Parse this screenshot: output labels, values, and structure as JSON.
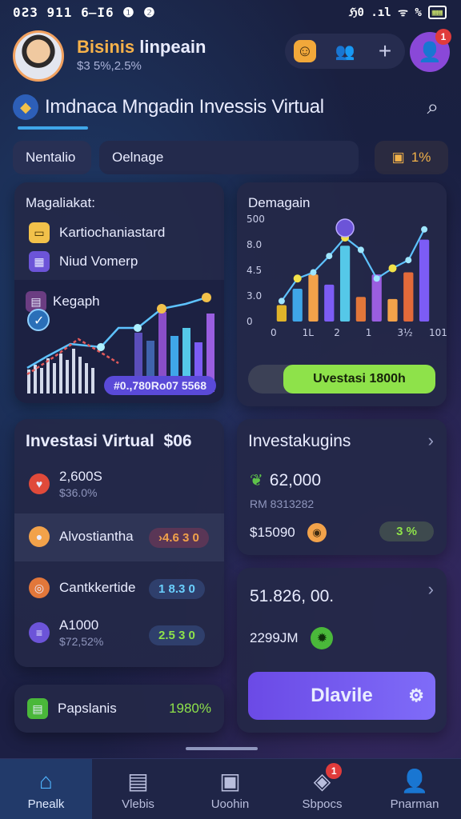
{
  "status": {
    "time": "0Ƨ3 911 6̶Ι6 ❶ ❷",
    "right": "ℌ0 .ıl ᯤ %",
    "battery": "▦▦"
  },
  "profile": {
    "name_hi": "Bisinis",
    "name_rest": "linpeain",
    "sub": "$3 5%,2.5%",
    "badge": "1"
  },
  "header": {
    "title": "Imdnaca Mngadin Invessis Virtual"
  },
  "tabs": {
    "t1": "Nentalio",
    "t2": "Oelnage",
    "t3": "1%"
  },
  "left_card": {
    "title": "Magaliakat:",
    "item1": "Kartiochaniastard",
    "item2": "Niud Vomerp",
    "graph_label": "Kegaph",
    "graph_value": "#0.,780Ro07 5568"
  },
  "right_chart": {
    "title": "Demagain",
    "button": "Uvestasi 1800h",
    "y_ticks": [
      "500",
      "8.0",
      "4.5",
      "3.0",
      "0"
    ],
    "x_ticks": [
      "0",
      "1L",
      "2",
      "1",
      "3½",
      "101"
    ]
  },
  "chart_data": {
    "type": "bar",
    "title": "Demagain",
    "categories": [
      "0",
      "",
      "1L",
      "",
      "2",
      "",
      "1",
      "",
      "3½",
      "101"
    ],
    "values": [
      0.8,
      1.6,
      2.3,
      1.8,
      3.7,
      1.2,
      2.3,
      1.1,
      2.4,
      4.0
    ],
    "line": [
      1.0,
      2.1,
      2.4,
      3.2,
      4.1,
      3.5,
      2.1,
      2.6,
      3.0,
      4.5
    ],
    "ylim": [
      0,
      5
    ]
  },
  "invest_card": {
    "title": "Investasi Virtual",
    "title_value": "$06",
    "r1_main": "2,600S",
    "r1_sub": "$36.0%",
    "r2_label": "Alvostiantha",
    "r2_value": "›4.6 3 0",
    "r3_label": "Cantkkertide",
    "r3_value": "1 8.3 0",
    "r4_main": "A1000",
    "r4_sub": "$72,52%",
    "r4_value": "2.5 3 0"
  },
  "invest2": {
    "title": "Investakugins",
    "value": "62,000",
    "sub": "RM 8313282",
    "price": "$15090",
    "pct": "3 %"
  },
  "card3": {
    "value": "51.826, 00.",
    "sub": "2299JM",
    "button": "Dlavile"
  },
  "papers": {
    "label": "Papslanis",
    "value": "1980%"
  },
  "nav": [
    "Pnealk",
    "Vlebis",
    "Uoohin",
    "Sbpocs",
    "Pnarman"
  ],
  "nav_badge": "1",
  "colors": {
    "accent": "#3fa6e8",
    "purple": "#7c5cf5",
    "green": "#8ee24a",
    "orange": "#f2a24a"
  }
}
